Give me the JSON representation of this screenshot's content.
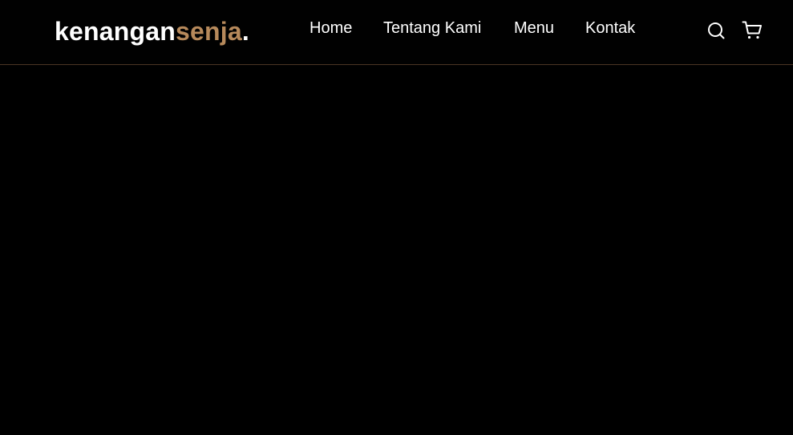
{
  "brand": {
    "name_part1": "kenangan",
    "name_part2": "senja",
    "name_part3": ".",
    "accent_color": "#b6895b"
  },
  "nav": {
    "links": [
      {
        "label": "Home"
      },
      {
        "label": "Tentang Kami"
      },
      {
        "label": "Menu"
      },
      {
        "label": "Kontak"
      }
    ]
  },
  "actions": {
    "search_icon": "search-icon",
    "cart_icon": "shopping-cart-icon"
  },
  "theme": {
    "background": "#000000",
    "text": "#ffffff",
    "divider": "#4a3524"
  }
}
